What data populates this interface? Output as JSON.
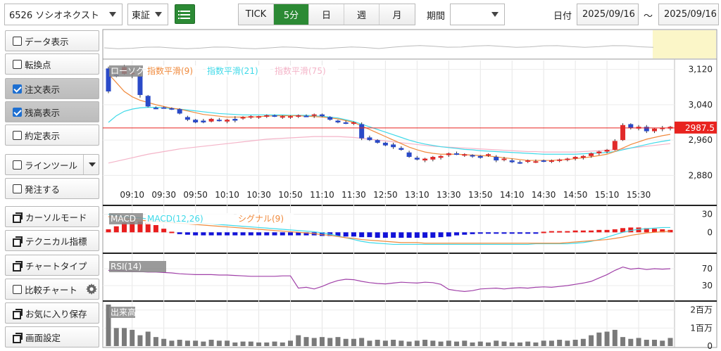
{
  "toolbar": {
    "symbol": "6526 ソシオネクスト",
    "market": "東証",
    "periods": [
      {
        "label": "TICK",
        "active": false
      },
      {
        "label": "5分",
        "active": true
      },
      {
        "label": "日",
        "active": false
      },
      {
        "label": "週",
        "active": false
      },
      {
        "label": "月",
        "active": false
      }
    ],
    "kikan_label": "期間",
    "kikan_value": "",
    "date_label": "日付",
    "date_from": "2025/09/16",
    "tilde": "～",
    "date_to": "2025/09/16"
  },
  "sidebar": {
    "data_display": "データ表示",
    "turning_point": "転換点",
    "order_display": "注文表示",
    "balance_display": "残高表示",
    "execution_display": "約定表示",
    "line_tool": "ラインツール",
    "order_entry": "発注する",
    "cursor_mode": "カーソルモード",
    "technical": "テクニカル指標",
    "chart_type": "チャートタイプ",
    "compare_chart": "比較チャート",
    "favorite_save": "お気に入り保存",
    "screen_settings": "画面設定"
  },
  "checked": {
    "data_display": false,
    "turning_point": false,
    "order_display": true,
    "balance_display": true,
    "execution_display": false,
    "line_tool": false,
    "order_entry": false,
    "compare_chart": false
  },
  "colors": {
    "up": "#e12a2a",
    "down": "#2a4ac8",
    "ema9": "#f08a3c",
    "ema21": "#3fd9e8",
    "ema75": "#f4b4c8",
    "rsi": "#a040a8",
    "volume": "#7a7a7a",
    "accent": "#2c8a35",
    "price_tag": "#e8231f"
  },
  "chart_data": [
    {
      "type": "candlestick",
      "legend": [
        "ローソク",
        "指数平滑(9)",
        "指数平滑(21)",
        "指数平滑(75)"
      ],
      "y_ticks": [
        "3,120",
        "3,040",
        "2,960",
        "2,880"
      ],
      "ylim": [
        2860,
        3140
      ],
      "current_price": "2987.5",
      "x_ticks": [
        "09:10",
        "09:30",
        "09:50",
        "10:10",
        "10:30",
        "10:50",
        "11:10",
        "11:30",
        "12:50",
        "13:10",
        "13:30",
        "13:50",
        "14:10",
        "14:30",
        "14:50",
        "15:10",
        "15:30"
      ],
      "candles": [
        [
          3122,
          3126,
          3066,
          3070
        ],
        [
          3108,
          3112,
          3102,
          3105
        ],
        [
          3110,
          3130,
          3108,
          3125
        ],
        [
          3112,
          3120,
          3100,
          3112
        ],
        [
          3105,
          3110,
          3056,
          3062
        ],
        [
          3060,
          3062,
          3034,
          3036
        ],
        [
          3033,
          3036,
          3030,
          3032
        ],
        [
          3034,
          3036,
          3032,
          3033
        ],
        [
          3032,
          3034,
          3028,
          3031
        ],
        [
          3030,
          3032,
          3018,
          3020
        ],
        [
          3012,
          3015,
          3003,
          3006
        ],
        [
          3006,
          3008,
          2998,
          3000
        ],
        [
          3004,
          3008,
          2998,
          3000
        ],
        [
          3002,
          3010,
          3000,
          3008
        ],
        [
          3006,
          3010,
          3002,
          3004
        ],
        [
          3002,
          3008,
          2998,
          3006
        ],
        [
          3008,
          3014,
          3000,
          3004
        ],
        [
          3010,
          3014,
          3006,
          3012
        ],
        [
          3012,
          3016,
          3008,
          3014
        ],
        [
          3012,
          3015,
          3008,
          3014
        ],
        [
          3014,
          3018,
          3010,
          3016
        ],
        [
          3016,
          3018,
          3012,
          3015
        ],
        [
          3012,
          3016,
          3008,
          3014
        ],
        [
          3012,
          3016,
          3008,
          3014
        ],
        [
          3014,
          3018,
          3010,
          3016
        ],
        [
          3015,
          3018,
          3012,
          3014
        ],
        [
          3016,
          3020,
          3010,
          3018
        ],
        [
          3018,
          3020,
          3012,
          3014
        ],
        [
          3012,
          3014,
          3004,
          3006
        ],
        [
          3004,
          3006,
          2998,
          3000
        ],
        [
          3000,
          3004,
          2996,
          2998
        ],
        [
          2998,
          3002,
          2994,
          3000
        ],
        [
          2996,
          3000,
          2960,
          2964
        ],
        [
          2966,
          2970,
          2958,
          2960
        ],
        [
          2960,
          2962,
          2952,
          2954
        ],
        [
          2954,
          2956,
          2946,
          2948
        ],
        [
          2950,
          2954,
          2940,
          2944
        ],
        [
          2942,
          2946,
          2936,
          2938
        ],
        [
          2932,
          2936,
          2920,
          2922
        ],
        [
          2920,
          2924,
          2914,
          2916
        ],
        [
          2914,
          2920,
          2910,
          2918
        ],
        [
          2916,
          2924,
          2912,
          2922
        ],
        [
          2920,
          2926,
          2916,
          2924
        ],
        [
          2926,
          2932,
          2922,
          2930
        ],
        [
          2930,
          2934,
          2926,
          2928
        ],
        [
          2926,
          2930,
          2922,
          2928
        ],
        [
          2926,
          2928,
          2920,
          2924
        ],
        [
          2924,
          2926,
          2918,
          2920
        ],
        [
          2926,
          2930,
          2922,
          2928
        ],
        [
          2922,
          2926,
          2910,
          2914
        ],
        [
          2916,
          2922,
          2912,
          2918
        ],
        [
          2914,
          2918,
          2908,
          2910
        ],
        [
          2910,
          2914,
          2906,
          2908
        ],
        [
          2912,
          2916,
          2908,
          2914
        ],
        [
          2912,
          2916,
          2908,
          2912
        ],
        [
          2914,
          2916,
          2910,
          2912
        ],
        [
          2912,
          2916,
          2908,
          2914
        ],
        [
          2914,
          2918,
          2910,
          2916
        ],
        [
          2916,
          2920,
          2912,
          2918
        ],
        [
          2918,
          2924,
          2914,
          2922
        ],
        [
          2920,
          2926,
          2916,
          2924
        ],
        [
          2924,
          2932,
          2920,
          2930
        ],
        [
          2930,
          2936,
          2926,
          2934
        ],
        [
          2934,
          2940,
          2930,
          2938
        ],
        [
          2938,
          2962,
          2936,
          2958
        ],
        [
          2960,
          2998,
          2958,
          2994
        ],
        [
          2996,
          2998,
          2984,
          2988
        ],
        [
          2986,
          2994,
          2982,
          2990
        ],
        [
          2990,
          2994,
          2976,
          2980
        ],
        [
          2980,
          2988,
          2976,
          2986
        ],
        [
          2986,
          2992,
          2980,
          2988
        ],
        [
          2986,
          2992,
          2982,
          2990
        ]
      ],
      "ema9": [
        3110,
        3090,
        3070,
        3058,
        3050,
        3045,
        3040,
        3036,
        3032,
        3030,
        3026,
        3022,
        3018,
        3016,
        3014,
        3012,
        3012,
        3012,
        3012,
        3013,
        3014,
        3015,
        3015,
        3015,
        3015,
        3014,
        3013,
        3012,
        3010,
        3008,
        3004,
        3000,
        2992,
        2984,
        2976,
        2968,
        2960,
        2952,
        2944,
        2938,
        2933,
        2930,
        2928,
        2928,
        2928,
        2927,
        2926,
        2925,
        2924,
        2922,
        2920,
        2918,
        2916,
        2914,
        2914,
        2914,
        2914,
        2915,
        2916,
        2918,
        2920,
        2922,
        2925,
        2928,
        2934,
        2942,
        2950,
        2956,
        2962,
        2966,
        2970,
        2973
      ],
      "ema21": [
        3000,
        3015,
        3025,
        3030,
        3033,
        3034,
        3034,
        3033,
        3031,
        3030,
        3028,
        3026,
        3024,
        3022,
        3020,
        3019,
        3018,
        3017,
        3017,
        3017,
        3017,
        3017,
        3017,
        3016,
        3016,
        3016,
        3015,
        3014,
        3012,
        3010,
        3006,
        3002,
        2996,
        2990,
        2984,
        2978,
        2972,
        2966,
        2960,
        2955,
        2951,
        2948,
        2945,
        2943,
        2941,
        2939,
        2938,
        2936,
        2935,
        2934,
        2933,
        2932,
        2931,
        2930,
        2929,
        2928,
        2928,
        2928,
        2928,
        2928,
        2929,
        2930,
        2931,
        2932,
        2934,
        2938,
        2942,
        2946,
        2950,
        2954,
        2957,
        2960
      ],
      "ema75": [
        2908,
        2912,
        2916,
        2920,
        2924,
        2928,
        2931,
        2934,
        2937,
        2940,
        2942,
        2944,
        2946,
        2948,
        2950,
        2952,
        2954,
        2956,
        2958,
        2960,
        2962,
        2963,
        2964,
        2965,
        2966,
        2967,
        2968,
        2968,
        2968,
        2968,
        2967,
        2966,
        2964,
        2962,
        2960,
        2958,
        2956,
        2954,
        2952,
        2950,
        2948,
        2946,
        2945,
        2944,
        2943,
        2942,
        2941,
        2940,
        2939,
        2938,
        2937,
        2936,
        2935,
        2934,
        2934,
        2933,
        2933,
        2933,
        2933,
        2933,
        2934,
        2935,
        2936,
        2937,
        2938,
        2940,
        2942,
        2944,
        2946,
        2948,
        2950,
        2952
      ]
    },
    {
      "type": "bar+line",
      "legend": [
        "MACD",
        "MACD(12,26)",
        "シグナル(9)"
      ],
      "y_ticks": [
        "30",
        "0"
      ],
      "ylim": [
        -30,
        40
      ],
      "histogram": [
        5,
        10,
        16,
        18,
        18,
        16,
        12,
        6,
        1,
        -3,
        -4,
        -5,
        -5,
        -5,
        -5,
        -5,
        -5,
        -5,
        -5,
        -5,
        -5,
        -5,
        -5,
        -5,
        -5,
        -5,
        -5,
        -6,
        -6,
        -6,
        -7,
        -7,
        -8,
        -8,
        -9,
        -9,
        -9,
        -9,
        -9,
        -9,
        -9,
        -9,
        -8,
        -7,
        -5,
        -4,
        -3,
        -2,
        -2,
        -2,
        -2,
        -2,
        -2,
        -2,
        -1,
        1,
        2,
        2,
        2,
        3,
        3,
        3,
        4,
        4,
        5,
        7,
        8,
        8,
        7,
        6,
        5,
        4
      ],
      "macd": [
        30,
        28,
        26,
        25,
        24,
        22,
        21,
        20,
        19,
        18,
        17,
        16,
        15,
        14,
        13,
        12,
        11,
        10,
        9,
        8,
        7,
        6,
        5,
        4,
        3,
        2,
        1,
        -1,
        -3,
        -6,
        -9,
        -12,
        -15,
        -17,
        -18,
        -19,
        -20,
        -20,
        -20,
        -20,
        -20,
        -20,
        -20,
        -20,
        -20,
        -20,
        -20,
        -20,
        -20,
        -20,
        -20,
        -20,
        -20,
        -20,
        -19,
        -19,
        -19,
        -19,
        -19,
        -18,
        -17,
        -15,
        -12,
        -8,
        -4,
        0,
        3,
        5,
        6,
        7,
        8,
        8
      ],
      "signal": [
        26,
        24,
        22,
        21,
        20,
        19,
        18,
        17,
        16,
        15,
        14,
        13,
        12,
        11,
        10,
        9,
        8,
        7,
        6,
        5,
        4,
        3,
        2,
        1,
        0,
        -1,
        -2,
        -4,
        -5,
        -7,
        -9,
        -10,
        -12,
        -13,
        -14,
        -15,
        -16,
        -17,
        -17,
        -17,
        -18,
        -18,
        -18,
        -18,
        -18,
        -18,
        -18,
        -18,
        -18,
        -18,
        -18,
        -18,
        -18,
        -18,
        -18,
        -18,
        -18,
        -18,
        -17,
        -16,
        -15,
        -14,
        -13,
        -12,
        -10,
        -8,
        -5,
        -3,
        -1,
        0,
        1,
        2
      ]
    },
    {
      "type": "line",
      "legend": [
        "RSI(14)"
      ],
      "y_ticks": [
        "70",
        "30"
      ],
      "ylim": [
        0,
        100
      ],
      "rsi": [
        66,
        66,
        65,
        64,
        63,
        62,
        62,
        61,
        60,
        58,
        57,
        56,
        56,
        56,
        55,
        55,
        54,
        53,
        52,
        52,
        52,
        52,
        53,
        53,
        24,
        26,
        22,
        28,
        36,
        42,
        45,
        44,
        40,
        37,
        35,
        34,
        36,
        38,
        37,
        36,
        38,
        37,
        33,
        21,
        18,
        16,
        18,
        22,
        23,
        24,
        22,
        24,
        25,
        24,
        26,
        27,
        26,
        28,
        30,
        33,
        36,
        40,
        48,
        56,
        66,
        74,
        69,
        71,
        68,
        70,
        69,
        70
      ]
    },
    {
      "type": "bar",
      "legend": [
        "出来高"
      ],
      "y_ticks": [
        "2百万",
        "1百万",
        "0"
      ],
      "ylim": [
        0,
        2.3
      ],
      "volume": [
        2.3,
        1.0,
        1.0,
        0.9,
        0.6,
        0.8,
        0.5,
        0.4,
        0.3,
        0.35,
        0.3,
        0.3,
        0.25,
        0.35,
        0.3,
        0.3,
        0.2,
        0.25,
        0.25,
        0.2,
        0.2,
        0.25,
        0.2,
        0.3,
        0.6,
        0.5,
        0.45,
        0.5,
        0.45,
        0.5,
        0.4,
        0.4,
        0.45,
        0.3,
        0.35,
        0.3,
        0.35,
        0.3,
        0.25,
        0.3,
        0.35,
        0.3,
        0.25,
        0.3,
        0.25,
        0.3,
        0.2,
        0.25,
        0.2,
        0.3,
        0.25,
        0.2,
        0.2,
        0.25,
        0.2,
        0.3,
        0.3,
        0.35,
        0.3,
        0.35,
        0.4,
        0.6,
        0.75,
        0.8,
        0.9,
        0.5,
        0.4,
        0.45,
        0.35,
        0.35,
        0.3,
        0.45
      ]
    }
  ]
}
